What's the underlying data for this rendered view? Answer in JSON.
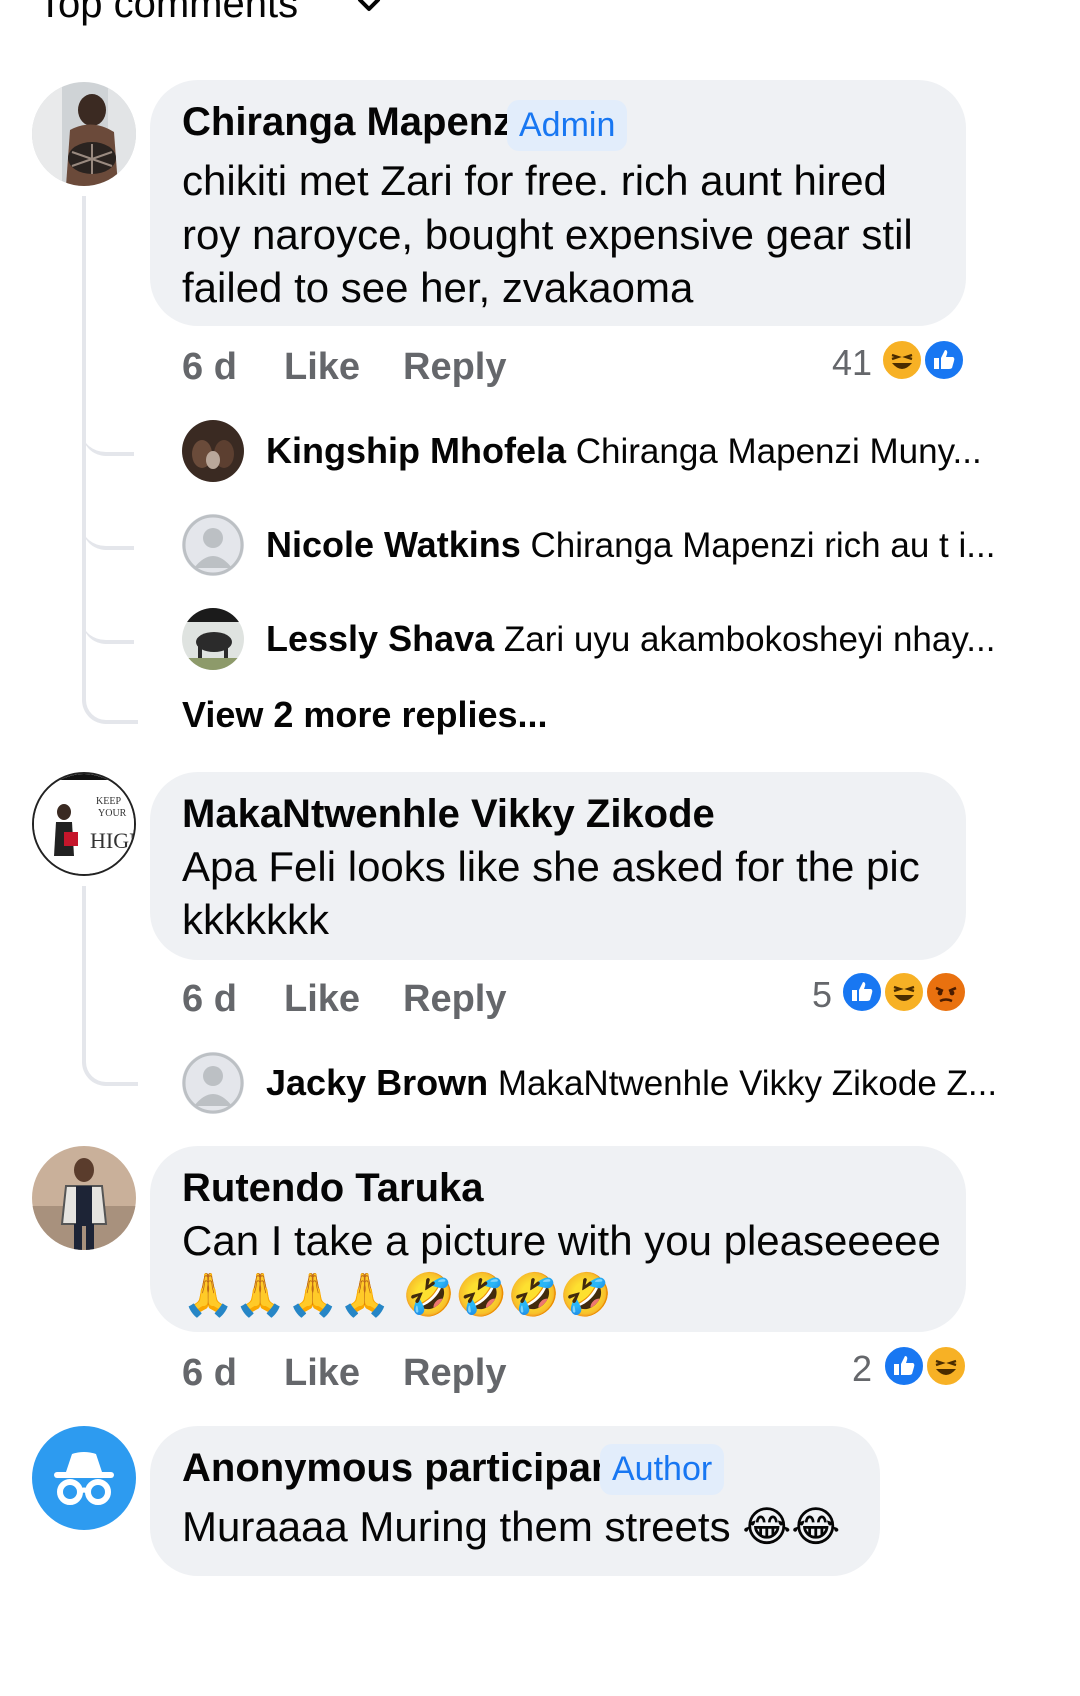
{
  "header": {
    "title": "Top comments"
  },
  "comments": [
    {
      "author": "Chiranga Mapenzi",
      "badge": "Admin",
      "lines": [
        "chikiti met Zari for free. rich aunt hired",
        "roy naroyce, bought expensive gear stil",
        "failed to see her, zvakaoma"
      ],
      "time": "6 d",
      "like": "Like",
      "reply": "Reply",
      "reaction_count": "41",
      "reactions": [
        "haha-icon",
        "like-icon"
      ],
      "replies": [
        {
          "author": "Kingship Mhofela",
          "text": "Chiranga Mapenzi  Muny..."
        },
        {
          "author": "Nicole Watkins",
          "text": "Chiranga Mapenzi rich au t i..."
        },
        {
          "author": "Lessly Shava",
          "text": "Zari uyu akambokosheyi nhay..."
        }
      ],
      "more_replies": "View 2 more replies..."
    },
    {
      "author": "MakaNtwenhle Vikky Zikode",
      "lines": [
        "Apa Feli looks like she asked for the pic",
        "kkkkkkk"
      ],
      "time": "6 d",
      "like": "Like",
      "reply": "Reply",
      "reaction_count": "5",
      "reactions": [
        "like-icon",
        "haha-icon",
        "angry-icon"
      ],
      "avatar_text": [
        "KEEP",
        "YOUR",
        "HIGH"
      ],
      "replies": [
        {
          "author": "Jacky Brown",
          "text": "MakaNtwenhle Vikky Zikode Z..."
        }
      ]
    },
    {
      "author": "Rutendo Taruka",
      "lines": [
        "Can I take a picture with you pleaseeeee"
      ],
      "emoji_line": "🙏🙏🙏🙏 🤣🤣🤣🤣",
      "time": "6 d",
      "like": "Like",
      "reply": "Reply",
      "reaction_count": "2",
      "reactions": [
        "like-icon",
        "haha-icon"
      ]
    },
    {
      "author": "Anonymous participant",
      "badge": "Author",
      "text": "Muraaaa Muring them streets 😂😂"
    }
  ],
  "colors": {
    "accent": "#1877f2",
    "bubble": "#eff1f4",
    "meta": "#65676b",
    "haha": "#f7b125",
    "angry": "#e9710f",
    "anon_avatar": "#2d9bf0"
  }
}
